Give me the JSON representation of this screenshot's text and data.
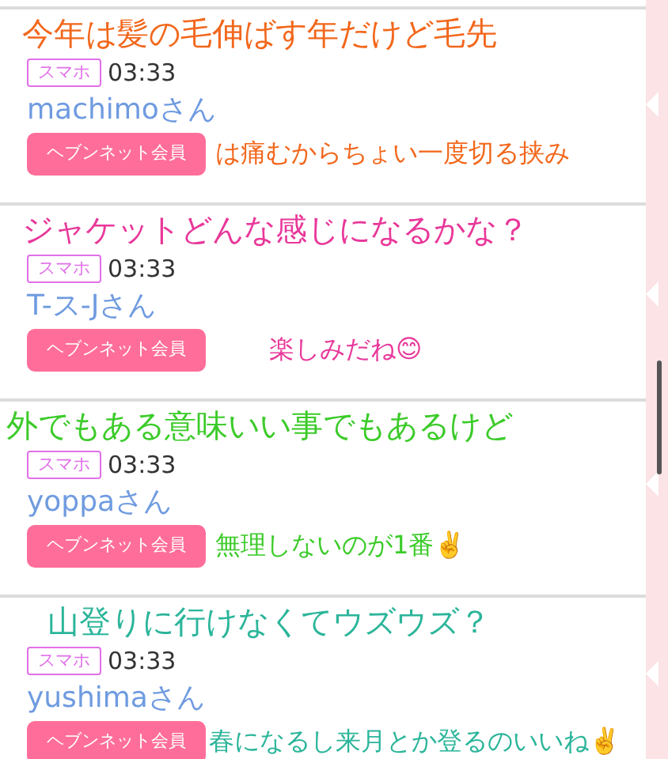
{
  "comments": [
    {
      "device": "スマホ",
      "time": "03:33",
      "name": "machimoさん",
      "member_button": "ヘブンネット会員",
      "overlay": {
        "color": "#f2671c",
        "lines": [
          "今年は髪の毛伸ばす年だけど毛先",
          "は痛むからちょい一度切る挟み"
        ]
      }
    },
    {
      "device": "スマホ",
      "time": "03:33",
      "name": "T-ス-Jさん",
      "member_button": "ヘブンネット会員",
      "overlay": {
        "color": "#e8389a",
        "lines": [
          "ジャケットどんな感じになるかな？",
          "楽しみだね😊"
        ]
      }
    },
    {
      "device": "スマホ",
      "time": "03:33",
      "name": "yoppaさん",
      "member_button": "ヘブンネット会員",
      "overlay": {
        "color": "#3ccb2a",
        "lines": [
          "外でもある意味いい事でもあるけど",
          "無理しないのが1番✌️"
        ]
      }
    },
    {
      "device": "スマホ",
      "time": "03:33",
      "name": "yushimaさん",
      "member_button": "ヘブンネット会員",
      "overlay": {
        "color": "#2bb59a",
        "lines": [
          "山登りに行けなくてウズウズ？",
          "春になるし来月とか登るのいいね✌️"
        ]
      }
    }
  ]
}
